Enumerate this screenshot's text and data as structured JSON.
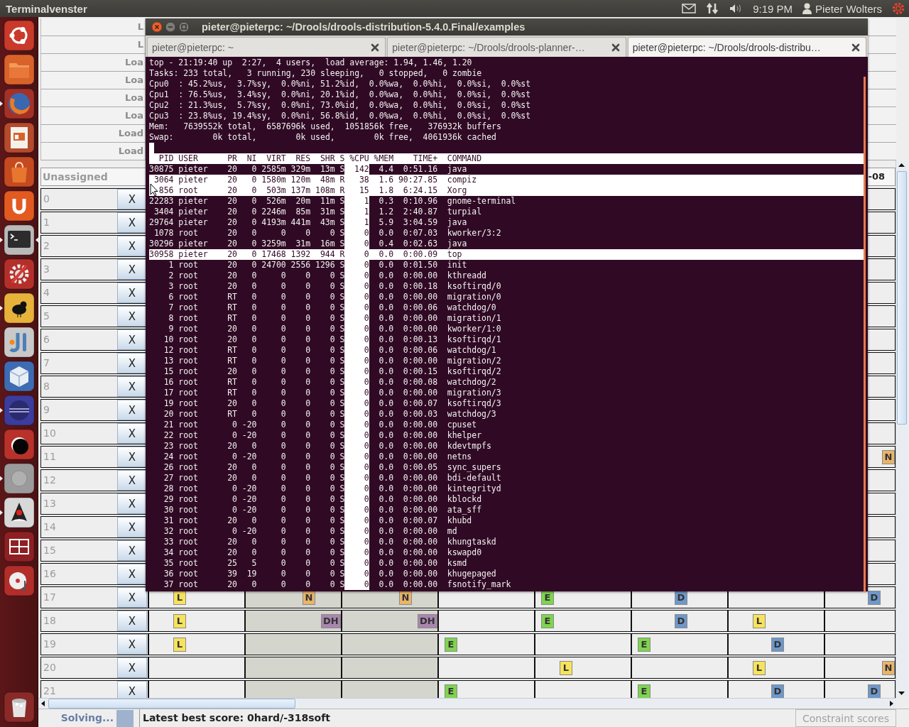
{
  "top_panel": {
    "app_title": "Terminalvenster",
    "clock": "9:19 PM",
    "user": "Pieter Wolters"
  },
  "launcher": [
    {
      "kind": "ubuntu",
      "running": false,
      "focused": false
    },
    {
      "kind": "files",
      "running": false,
      "focused": false
    },
    {
      "kind": "browser",
      "running": true,
      "focused": false
    },
    {
      "kind": "presentation",
      "running": false,
      "focused": false
    },
    {
      "kind": "software",
      "running": false,
      "focused": false
    },
    {
      "kind": "cloud",
      "running": false,
      "focused": false
    },
    {
      "kind": "terminal",
      "running": true,
      "focused": true
    },
    {
      "kind": "settings",
      "running": false,
      "focused": false
    },
    {
      "kind": "bird",
      "running": true,
      "focused": false
    },
    {
      "kind": "ide",
      "running": false,
      "focused": false
    },
    {
      "kind": "cube",
      "running": false,
      "focused": false
    },
    {
      "kind": "sphere",
      "running": true,
      "focused": false
    },
    {
      "kind": "crescent",
      "running": false,
      "focused": false
    },
    {
      "kind": "help",
      "running": true,
      "focused": false
    },
    {
      "kind": "figure",
      "running": true,
      "focused": false
    },
    {
      "kind": "workspaces",
      "running": false,
      "focused": false
    },
    {
      "kind": "music",
      "running": false,
      "focused": false
    },
    {
      "kind": "trash",
      "running": false,
      "focused": false
    }
  ],
  "planner": {
    "header_rows": [
      {
        "label": "L"
      },
      {
        "label": "L"
      },
      {
        "label": "Loa"
      },
      {
        "label": "Loa"
      },
      {
        "label": "Loa"
      },
      {
        "label": "Loa"
      },
      {
        "label": "Load"
      },
      {
        "label": "Load"
      }
    ],
    "unassigned_row": {
      "label": "Unassigned",
      "column_8": "-08"
    },
    "rows": [
      {
        "label": "0",
        "button": "X",
        "cells": [
          {
            "shaded": false
          }
        ]
      },
      {
        "label": "1",
        "button": "X",
        "cells": [
          {
            "shaded": false
          }
        ]
      },
      {
        "label": "2",
        "button": "X",
        "cells": [
          {
            "shaded": false
          }
        ]
      },
      {
        "label": "3",
        "button": "X",
        "cells": [
          {
            "shaded": false
          }
        ]
      },
      {
        "label": "4",
        "button": "X",
        "cells": [
          {
            "shaded": false
          }
        ]
      },
      {
        "label": "5",
        "button": "X",
        "cells": [
          {
            "shaded": false
          }
        ]
      },
      {
        "label": "6",
        "button": "X",
        "cells": [
          {
            "shaded": false
          }
        ]
      },
      {
        "label": "7",
        "button": "X",
        "cells": [
          {
            "shaded": false
          }
        ]
      },
      {
        "label": "8",
        "button": "X",
        "cells": [
          {
            "shaded": false
          }
        ]
      },
      {
        "label": "9",
        "button": "X",
        "cells": [
          {
            "shaded": false
          }
        ]
      },
      {
        "label": "10",
        "button": "X",
        "cells": [
          {
            "shaded": false
          }
        ]
      },
      {
        "label": "11",
        "button": "X",
        "cells": [
          {
            "shaded": false,
            "tags": [
              {
                "label": "N",
                "kind": "night",
                "color": "#e8b46a"
              }
            ]
          }
        ]
      },
      {
        "label": "12",
        "button": "X",
        "cells": [
          {
            "shaded": false
          }
        ]
      },
      {
        "label": "13",
        "button": "X",
        "cells": [
          {
            "shaded": false
          }
        ]
      },
      {
        "label": "14",
        "button": "X",
        "cells": [
          {
            "shaded": false
          }
        ]
      },
      {
        "label": "15",
        "button": "X",
        "cells": [
          {
            "shaded": false
          }
        ]
      },
      {
        "label": "16",
        "button": "X",
        "cells": [
          {
            "shaded": false
          }
        ]
      },
      {
        "label": "17",
        "button": "X",
        "cells": [
          {
            "shaded": false,
            "tags": [
              {
                "label": "L",
                "kind": "late",
                "color": "#f7e35b"
              }
            ]
          },
          {
            "shaded": true,
            "tags": [
              {
                "label": "N",
                "kind": "night",
                "color": "#e8b46a"
              }
            ]
          },
          {
            "shaded": true,
            "tags": [
              {
                "label": "N",
                "kind": "night",
                "color": "#e8b46a"
              }
            ]
          },
          {
            "shaded": false
          },
          {
            "shaded": false,
            "tags": [
              {
                "label": "E",
                "kind": "early",
                "color": "#7fd44e"
              }
            ]
          },
          {
            "shaded": false,
            "tags": [
              {
                "label": "D",
                "kind": "day",
                "color": "#6e98c9"
              }
            ]
          },
          {
            "shaded": false
          },
          {
            "shaded": false,
            "tags": [
              {
                "label": "D",
                "kind": "day",
                "color": "#6e98c9"
              }
            ]
          }
        ]
      },
      {
        "label": "18",
        "button": "X",
        "cells": [
          {
            "shaded": false,
            "tags": [
              {
                "label": "L",
                "kind": "late",
                "color": "#f7e35b"
              }
            ]
          },
          {
            "shaded": true,
            "tags": [
              {
                "label": "DH",
                "kind": "dayhalf",
                "color": "#a986ae"
              }
            ]
          },
          {
            "shaded": true,
            "tags": [
              {
                "label": "DH",
                "kind": "dayhalf",
                "color": "#a986ae"
              }
            ]
          },
          {
            "shaded": false
          },
          {
            "shaded": false,
            "tags": [
              {
                "label": "E",
                "kind": "early",
                "color": "#7fd44e"
              }
            ]
          },
          {
            "shaded": false,
            "tags": [
              {
                "label": "D",
                "kind": "day",
                "color": "#6e98c9"
              }
            ]
          },
          {
            "shaded": false,
            "tags": [
              {
                "label": "L",
                "kind": "late",
                "color": "#f7e35b"
              }
            ]
          },
          {
            "shaded": false
          }
        ]
      },
      {
        "label": "19",
        "button": "X",
        "cells": [
          {
            "shaded": false,
            "tags": [
              {
                "label": "L",
                "kind": "late",
                "color": "#f7e35b"
              }
            ]
          },
          {
            "shaded": true
          },
          {
            "shaded": true
          },
          {
            "shaded": false,
            "tags": [
              {
                "label": "E",
                "kind": "early",
                "color": "#7fd44e"
              }
            ]
          },
          {
            "shaded": false
          },
          {
            "shaded": false,
            "tags": [
              {
                "label": "E",
                "kind": "early",
                "color": "#7fd44e"
              }
            ]
          },
          {
            "shaded": false,
            "tags": [
              {
                "label": "D",
                "kind": "day",
                "color": "#6e98c9"
              }
            ]
          },
          {
            "shaded": false
          }
        ]
      },
      {
        "label": "20",
        "button": "X",
        "cells": [
          {
            "shaded": false
          },
          {
            "shaded": true
          },
          {
            "shaded": true
          },
          {
            "shaded": false
          },
          {
            "shaded": false,
            "tags": [
              {
                "label": "L",
                "kind": "late",
                "color": "#f7e35b"
              }
            ]
          },
          {
            "shaded": false
          },
          {
            "shaded": false,
            "tags": [
              {
                "label": "L",
                "kind": "late",
                "color": "#f7e35b"
              }
            ]
          },
          {
            "shaded": false,
            "tags": [
              {
                "label": "N",
                "kind": "night",
                "color": "#e8b46a"
              }
            ]
          }
        ]
      },
      {
        "label": "21",
        "button": "X",
        "cells": [
          {
            "shaded": false
          },
          {
            "shaded": true
          },
          {
            "shaded": true
          },
          {
            "shaded": false,
            "tags": [
              {
                "label": "E",
                "kind": "early",
                "color": "#7fd44e"
              }
            ]
          },
          {
            "shaded": false
          },
          {
            "shaded": false,
            "tags": [
              {
                "label": "E",
                "kind": "early",
                "color": "#7fd44e"
              }
            ]
          },
          {
            "shaded": false,
            "tags": [
              {
                "label": "D",
                "kind": "day",
                "color": "#6e98c9"
              }
            ]
          },
          {
            "shaded": false,
            "tags": [
              {
                "label": "D",
                "kind": "day",
                "color": "#6e98c9"
              }
            ]
          }
        ]
      }
    ],
    "status_bar": {
      "solving_label": "Solving...",
      "score": "Latest best score: 0hard/-318soft",
      "constraint_scores_button": {
        "label": "Constraint scores",
        "disabled": true
      }
    }
  },
  "terminal": {
    "title": "pieter@pieterpc: ~/Drools/drools-distribution-5.4.0.Final/examples",
    "tabs": [
      {
        "label": "pieter@pieterpc: ~",
        "selected": false
      },
      {
        "label": "pieter@pieterpc: ~/Drools/drools-planner-…",
        "selected": false
      },
      {
        "label": "pieter@pieterpc: ~/Drools/drools-distribu…",
        "selected": true
      }
    ],
    "summary_lines": [
      "top - 21:19:40 up  2:27,  4 users,  load average: 1.94, 1.46, 1.20",
      "Tasks: 233 total,   3 running, 230 sleeping,   0 stopped,   0 zombie",
      "Cpu0  : 45.2%us,  3.7%sy,  0.0%ni, 51.2%id,  0.0%wa,  0.0%hi,  0.0%si,  0.0%st",
      "Cpu1  : 76.5%us,  3.4%sy,  0.0%ni, 20.1%id,  0.0%wa,  0.0%hi,  0.0%si,  0.0%st",
      "Cpu2  : 21.3%us,  5.7%sy,  0.0%ni, 73.0%id,  0.0%wa,  0.0%hi,  0.0%si,  0.0%st",
      "Cpu3  : 23.8%us, 19.4%sy,  0.0%ni, 56.8%id,  0.0%wa,  0.0%hi,  0.0%si,  0.0%st",
      "Mem:   7639552k total,  6587696k used,  1051856k free,   376932k buffers",
      "Swap:        0k total,        0k used,        0k free,  4061936k cached"
    ],
    "process_columns": [
      {
        "label": "PID",
        "sorted": false
      },
      {
        "label": "USER",
        "sorted": false
      },
      {
        "label": "PR",
        "sorted": false
      },
      {
        "label": "NI",
        "sorted": false
      },
      {
        "label": "VIRT",
        "sorted": false
      },
      {
        "label": "RES",
        "sorted": false
      },
      {
        "label": "SHR",
        "sorted": false
      },
      {
        "label": "S",
        "sorted": false
      },
      {
        "label": "%CPU",
        "sorted": true
      },
      {
        "label": "%MEM",
        "sorted": false
      },
      {
        "label": "TIME+",
        "sorted": false
      },
      {
        "label": "COMMAND",
        "sorted": false
      }
    ],
    "processes": [
      {
        "highlighted": false,
        "cells": [
          "30875",
          "pieter",
          "20",
          "0",
          "2585m",
          "329m",
          "13m",
          "S",
          "142",
          "4.4",
          "0:51.16",
          "java"
        ]
      },
      {
        "highlighted": true,
        "cells": [
          "3064",
          "pieter",
          "20",
          "0",
          "1580m",
          "120m",
          "48m",
          "R",
          "38",
          "1.6",
          "90:27.85",
          "compiz"
        ]
      },
      {
        "highlighted": true,
        "cells": [
          "856",
          "root",
          "20",
          "0",
          "503m",
          "137m",
          "108m",
          "R",
          "15",
          "1.8",
          "6:24.15",
          "Xorg"
        ]
      },
      {
        "highlighted": false,
        "cells": [
          "22283",
          "pieter",
          "20",
          "0",
          "526m",
          "20m",
          "11m",
          "S",
          "1",
          "0.3",
          "0:10.96",
          "gnome-terminal"
        ]
      },
      {
        "highlighted": false,
        "cells": [
          "3404",
          "pieter",
          "20",
          "0",
          "2246m",
          "85m",
          "31m",
          "S",
          "1",
          "1.2",
          "2:40.87",
          "turpial"
        ]
      },
      {
        "highlighted": false,
        "cells": [
          "29764",
          "pieter",
          "20",
          "0",
          "4193m",
          "441m",
          "43m",
          "S",
          "1",
          "5.9",
          "3:04.59",
          "java"
        ]
      },
      {
        "highlighted": false,
        "cells": [
          "1078",
          "root",
          "20",
          "0",
          "0",
          "0",
          "0",
          "S",
          "0",
          "0.0",
          "0:07.03",
          "kworker/3:2"
        ]
      },
      {
        "highlighted": false,
        "cells": [
          "30296",
          "pieter",
          "20",
          "0",
          "3259m",
          "31m",
          "16m",
          "S",
          "0",
          "0.4",
          "0:02.63",
          "java"
        ]
      },
      {
        "highlighted": true,
        "cells": [
          "30958",
          "pieter",
          "20",
          "0",
          "17468",
          "1392",
          "944",
          "R",
          "0",
          "0.0",
          "0:00.09",
          "top"
        ]
      },
      {
        "highlighted": false,
        "cells": [
          "1",
          "root",
          "20",
          "0",
          "24700",
          "2556",
          "1296",
          "S",
          "0",
          "0.0",
          "0:01.50",
          "init"
        ]
      },
      {
        "highlighted": false,
        "cells": [
          "2",
          "root",
          "20",
          "0",
          "0",
          "0",
          "0",
          "S",
          "0",
          "0.0",
          "0:00.00",
          "kthreadd"
        ]
      },
      {
        "highlighted": false,
        "cells": [
          "3",
          "root",
          "20",
          "0",
          "0",
          "0",
          "0",
          "S",
          "0",
          "0.0",
          "0:00.18",
          "ksoftirqd/0"
        ]
      },
      {
        "highlighted": false,
        "cells": [
          "6",
          "root",
          "RT",
          "0",
          "0",
          "0",
          "0",
          "S",
          "0",
          "0.0",
          "0:00.00",
          "migration/0"
        ]
      },
      {
        "highlighted": false,
        "cells": [
          "7",
          "root",
          "RT",
          "0",
          "0",
          "0",
          "0",
          "S",
          "0",
          "0.0",
          "0:00.06",
          "watchdog/0"
        ]
      },
      {
        "highlighted": false,
        "cells": [
          "8",
          "root",
          "RT",
          "0",
          "0",
          "0",
          "0",
          "S",
          "0",
          "0.0",
          "0:00.00",
          "migration/1"
        ]
      },
      {
        "highlighted": false,
        "cells": [
          "9",
          "root",
          "20",
          "0",
          "0",
          "0",
          "0",
          "S",
          "0",
          "0.0",
          "0:00.00",
          "kworker/1:0"
        ]
      },
      {
        "highlighted": false,
        "cells": [
          "10",
          "root",
          "20",
          "0",
          "0",
          "0",
          "0",
          "S",
          "0",
          "0.0",
          "0:00.13",
          "ksoftirqd/1"
        ]
      },
      {
        "highlighted": false,
        "cells": [
          "12",
          "root",
          "RT",
          "0",
          "0",
          "0",
          "0",
          "S",
          "0",
          "0.0",
          "0:00.06",
          "watchdog/1"
        ]
      },
      {
        "highlighted": false,
        "cells": [
          "13",
          "root",
          "RT",
          "0",
          "0",
          "0",
          "0",
          "S",
          "0",
          "0.0",
          "0:00.00",
          "migration/2"
        ]
      },
      {
        "highlighted": false,
        "cells": [
          "15",
          "root",
          "20",
          "0",
          "0",
          "0",
          "0",
          "S",
          "0",
          "0.0",
          "0:00.15",
          "ksoftirqd/2"
        ]
      },
      {
        "highlighted": false,
        "cells": [
          "16",
          "root",
          "RT",
          "0",
          "0",
          "0",
          "0",
          "S",
          "0",
          "0.0",
          "0:00.08",
          "watchdog/2"
        ]
      },
      {
        "highlighted": false,
        "cells": [
          "17",
          "root",
          "RT",
          "0",
          "0",
          "0",
          "0",
          "S",
          "0",
          "0.0",
          "0:00.00",
          "migration/3"
        ]
      },
      {
        "highlighted": false,
        "cells": [
          "19",
          "root",
          "20",
          "0",
          "0",
          "0",
          "0",
          "S",
          "0",
          "0.0",
          "0:00.07",
          "ksoftirqd/3"
        ]
      },
      {
        "highlighted": false,
        "cells": [
          "20",
          "root",
          "RT",
          "0",
          "0",
          "0",
          "0",
          "S",
          "0",
          "0.0",
          "0:00.03",
          "watchdog/3"
        ]
      },
      {
        "highlighted": false,
        "cells": [
          "21",
          "root",
          "0",
          "-20",
          "0",
          "0",
          "0",
          "S",
          "0",
          "0.0",
          "0:00.00",
          "cpuset"
        ]
      },
      {
        "highlighted": false,
        "cells": [
          "22",
          "root",
          "0",
          "-20",
          "0",
          "0",
          "0",
          "S",
          "0",
          "0.0",
          "0:00.00",
          "khelper"
        ]
      },
      {
        "highlighted": false,
        "cells": [
          "23",
          "root",
          "20",
          "0",
          "0",
          "0",
          "0",
          "S",
          "0",
          "0.0",
          "0:00.00",
          "kdevtmpfs"
        ]
      },
      {
        "highlighted": false,
        "cells": [
          "24",
          "root",
          "0",
          "-20",
          "0",
          "0",
          "0",
          "S",
          "0",
          "0.0",
          "0:00.00",
          "netns"
        ]
      },
      {
        "highlighted": false,
        "cells": [
          "26",
          "root",
          "20",
          "0",
          "0",
          "0",
          "0",
          "S",
          "0",
          "0.0",
          "0:00.05",
          "sync_supers"
        ]
      },
      {
        "highlighted": false,
        "cells": [
          "27",
          "root",
          "20",
          "0",
          "0",
          "0",
          "0",
          "S",
          "0",
          "0.0",
          "0:00.00",
          "bdi-default"
        ]
      },
      {
        "highlighted": false,
        "cells": [
          "28",
          "root",
          "0",
          "-20",
          "0",
          "0",
          "0",
          "S",
          "0",
          "0.0",
          "0:00.00",
          "kintegrityd"
        ]
      },
      {
        "highlighted": false,
        "cells": [
          "29",
          "root",
          "0",
          "-20",
          "0",
          "0",
          "0",
          "S",
          "0",
          "0.0",
          "0:00.00",
          "kblockd"
        ]
      },
      {
        "highlighted": false,
        "cells": [
          "30",
          "root",
          "0",
          "-20",
          "0",
          "0",
          "0",
          "S",
          "0",
          "0.0",
          "0:00.00",
          "ata_sff"
        ]
      },
      {
        "highlighted": false,
        "cells": [
          "31",
          "root",
          "20",
          "0",
          "0",
          "0",
          "0",
          "S",
          "0",
          "0.0",
          "0:00.07",
          "khubd"
        ]
      },
      {
        "highlighted": false,
        "cells": [
          "32",
          "root",
          "0",
          "-20",
          "0",
          "0",
          "0",
          "S",
          "0",
          "0.0",
          "0:00.00",
          "md"
        ]
      },
      {
        "highlighted": false,
        "cells": [
          "33",
          "root",
          "20",
          "0",
          "0",
          "0",
          "0",
          "S",
          "0",
          "0.0",
          "0:00.00",
          "khungtaskd"
        ]
      },
      {
        "highlighted": false,
        "cells": [
          "34",
          "root",
          "20",
          "0",
          "0",
          "0",
          "0",
          "S",
          "0",
          "0.0",
          "0:00.00",
          "kswapd0"
        ]
      },
      {
        "highlighted": false,
        "cells": [
          "35",
          "root",
          "25",
          "5",
          "0",
          "0",
          "0",
          "S",
          "0",
          "0.0",
          "0:00.00",
          "ksmd"
        ]
      },
      {
        "highlighted": false,
        "cells": [
          "36",
          "root",
          "39",
          "19",
          "0",
          "0",
          "0",
          "S",
          "0",
          "0.0",
          "0:00.00",
          "khugepaged"
        ]
      },
      {
        "highlighted": false,
        "cells": [
          "37",
          "root",
          "20",
          "0",
          "0",
          "0",
          "0",
          "S",
          "0",
          "0.0",
          "0:00.00",
          "fsnotify_mark"
        ]
      }
    ]
  }
}
